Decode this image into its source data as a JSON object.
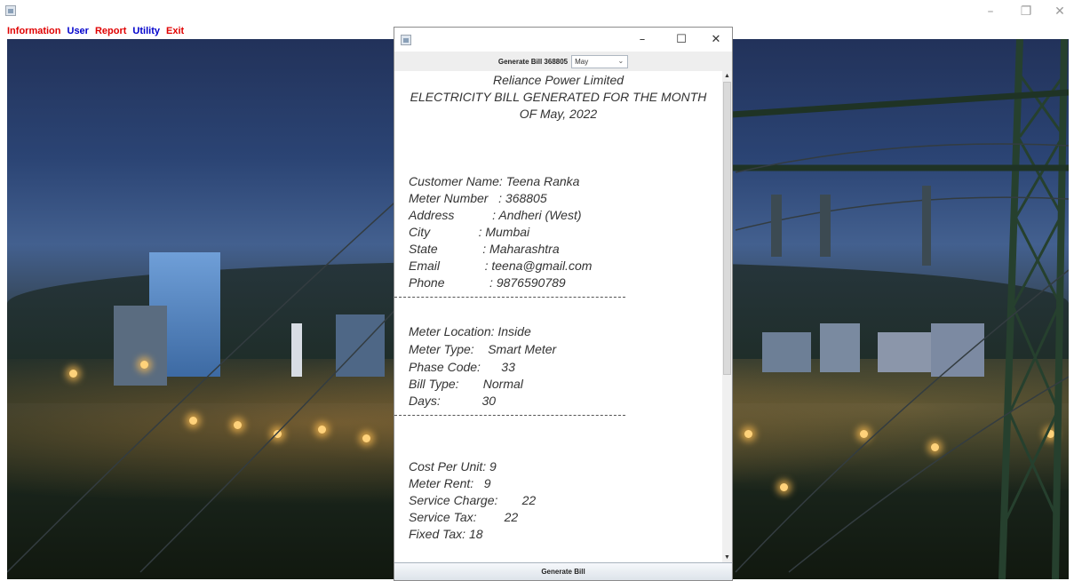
{
  "menubar": {
    "items": [
      {
        "label": "Information",
        "color": "#e00000"
      },
      {
        "label": "User",
        "color": "#0000cc"
      },
      {
        "label": "Report",
        "color": "#e00000"
      },
      {
        "label": "Utility",
        "color": "#0000cc"
      },
      {
        "label": "Exit",
        "color": "#e00000"
      }
    ]
  },
  "main_window": {
    "controls": {
      "minimize": "–",
      "restore": "❐",
      "close": "✕"
    }
  },
  "dialog": {
    "controls": {
      "minimize": "–",
      "maximize": "☐",
      "close": "✕"
    },
    "toolbar": {
      "label": "Generate Bill 368805",
      "selected_month": "May"
    },
    "bill": {
      "company": "Reliance Power Limited",
      "heading_line1": "ELECTRICITY BILL GENERATED FOR THE MONTH",
      "heading_line2": "OF May, 2022",
      "customer": [
        "Customer Name: Teena Ranka",
        "Meter Number   : 368805",
        "Address           : Andheri (West)",
        "City              : Mumbai",
        "State             : Maharashtra",
        "Email             : teena@gmail.com",
        "Phone             : 9876590789"
      ],
      "separator": "-------------------------------------------------------",
      "meter": [
        "Meter Location: Inside",
        "Meter Type:    Smart Meter",
        "Phase Code:      33",
        "Bill Type:       Normal",
        "Days:            30"
      ],
      "charges": [
        "Cost Per Unit: 9",
        "Meter Rent:   9",
        "Service Charge:       22",
        "Service Tax:        22",
        "Fixed Tax: 18"
      ]
    },
    "generate_button": "Generate Bill"
  }
}
